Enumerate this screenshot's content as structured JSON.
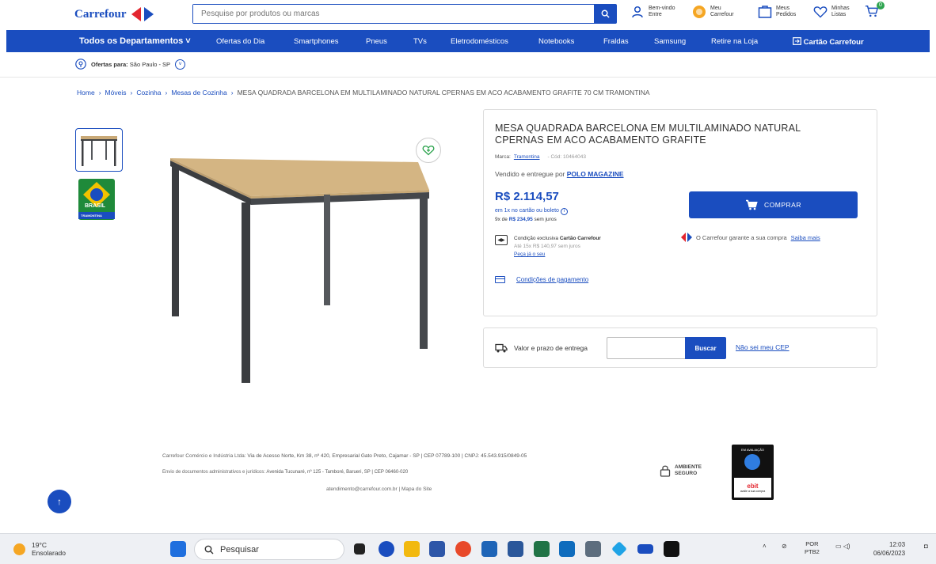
{
  "header": {
    "logo_text": "Carrefour",
    "search_placeholder": "Pesquise por produtos ou marcas",
    "welcome_line1": "Bem-vindo",
    "welcome_line2": "Entre",
    "my_carrefour_line1": "Meu",
    "my_carrefour_line2": "Carrefour",
    "orders_line1": "Meus",
    "orders_line2": "Pedidos",
    "lists_line1": "Minhas",
    "lists_line2": "Listas",
    "cart_count": "0"
  },
  "nav": {
    "items": [
      "Todos os Departamentos",
      "Ofertas do Dia",
      "Smartphones",
      "Pneus",
      "TVs",
      "Eletrodomésticos",
      "Notebooks",
      "Fraldas",
      "Samsung",
      "Retire na Loja",
      "Cartão Carrefour"
    ]
  },
  "location": {
    "label": "Ofertas para:",
    "value": "São Paulo - SP"
  },
  "breadcrumb": {
    "items": [
      "Home",
      "Móveis",
      "Cozinha",
      "Mesas de Cozinha"
    ],
    "current": "MESA QUADRADA BARCELONA EM MULTILAMINADO NATURAL CPERNAS EM ACO ACABAMENTO GRAFITE 70 CM TRAMONTINA"
  },
  "product": {
    "title": "MESA QUADRADA BARCELONA EM MULTILAMINADO NATURAL CPERNAS EM ACO ACABAMENTO GRAFITE",
    "brand_label": "Marca:",
    "brand": "Tramontina",
    "code": "- Cód: 10464043",
    "seller_prefix": "Vendido e entregue por",
    "seller": "POLO MAGAZINE",
    "price": "R$ 2.114,57",
    "cash_text": "em 1x no cartão ou boleto",
    "installments_prefix": "9x de",
    "installments_value": "R$ 234,95",
    "installments_suffix": "sem juros",
    "exclusive_prefix": "Condição exclusiva",
    "exclusive_brand": "Cartão Carrefour",
    "exclusive_detail": "Até 15x R$ 140,97 sem juros",
    "exclusive_link": "Peça já o seu",
    "payment_conditions": "Condições de pagamento",
    "buy_label": "COMPRAR",
    "guarantee_text": "O Carrefour garante a sua compra",
    "guarantee_link": "Saiba mais",
    "thumb_badge": "BRASIL",
    "thumb_badge_sub": "TRAMONTINA"
  },
  "shipping": {
    "label": "Valor e prazo de entrega",
    "button": "Buscar",
    "no_cep": "Não sei meu CEP"
  },
  "footer": {
    "company_label": "Carrefour Comércio e Indústria Ltda:",
    "company_address": "Via de Acesso Norte, Km 38, nº 420, Empresarial Gato Preto, Cajamar - SP | CEP 07789-100 | CNPJ: 45.543.915/0849-05",
    "docs_label": "Envio de documentos administrativos e jurídicos:",
    "docs_address": "Avenida Tucunaré, nº 125 - Tamboré, Barueri, SP | CEP 06460-020",
    "contact": "atendimento@carrefour.com.br | Mapa do Site",
    "secure_line1": "AMBIENTE",
    "secure_line2": "SEGURO",
    "ebit_top": "EM AVALIAÇÃO",
    "ebit_name": "ebit",
    "ebit_sub": "avalie a sua compra"
  },
  "taskbar": {
    "temp": "19°C",
    "weather": "Ensolarado",
    "search": "Pesquisar",
    "lang_line1": "POR",
    "lang_line2": "PTB2",
    "time": "12:03",
    "date": "06/06/2023"
  },
  "colors": {
    "brand_blue": "#1a4dbf",
    "brand_red": "#e3262f",
    "cart_green": "#2ea44f"
  }
}
